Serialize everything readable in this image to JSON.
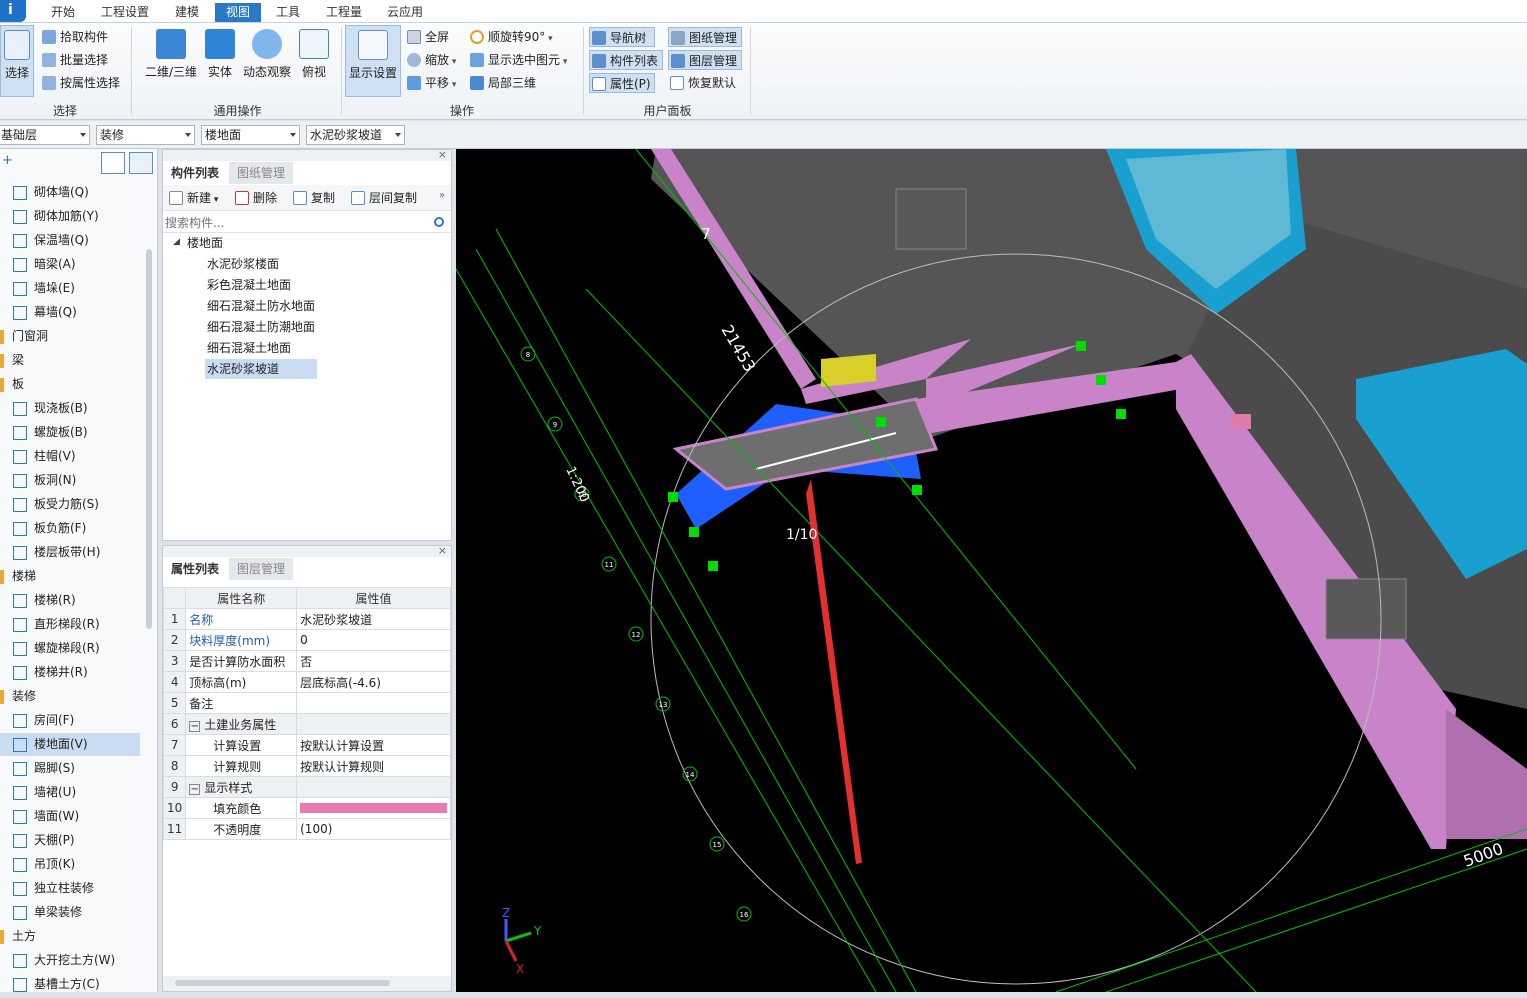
{
  "menu": {
    "tabs": [
      {
        "label": "开始",
        "active": false
      },
      {
        "label": "工程设置",
        "active": false
      },
      {
        "label": "建模",
        "active": false
      },
      {
        "label": "视图",
        "active": true
      },
      {
        "label": "工具",
        "active": false
      },
      {
        "label": "工程量",
        "active": false
      },
      {
        "label": "云应用",
        "active": false
      }
    ]
  },
  "ribbon": {
    "select_group": {
      "label": "选择",
      "select": "选择",
      "pick": "拾取构件",
      "batch": "批量选择",
      "by_attr": "按属性选择"
    },
    "general_group": {
      "label": "通用操作",
      "view2d3d": "二维/三维",
      "solid": "实体",
      "orbit": "动态观察",
      "top": "俯视"
    },
    "operate_group": {
      "label": "操作",
      "display": "显示设置",
      "fullscreen": "全屏",
      "zoom": "缩放",
      "pan": "平移",
      "rotate": "顺旋转90°",
      "show_selected": "显示选中图元",
      "local3d": "局部三维"
    },
    "panel_group": {
      "label": "用户面板",
      "nav_tree": "导航树",
      "drawing_mgmt": "图纸管理",
      "comp_list": "构件列表",
      "layer_mgmt": "图层管理",
      "props": "属性(P)",
      "restore": "恢复默认"
    }
  },
  "filters": {
    "floor": "基础层",
    "category": "装修",
    "type": "楼地面",
    "component": "水泥砂浆坡道"
  },
  "nav": {
    "items": [
      {
        "label": "砌体墙(Q)",
        "kind": "child"
      },
      {
        "label": "砌体加筋(Y)",
        "kind": "child"
      },
      {
        "label": "保温墙(Q)",
        "kind": "child"
      },
      {
        "label": "暗梁(A)",
        "kind": "child"
      },
      {
        "label": "墙垛(E)",
        "kind": "child"
      },
      {
        "label": "幕墙(Q)",
        "kind": "child"
      },
      {
        "label": "门窗洞",
        "kind": "group"
      },
      {
        "label": "梁",
        "kind": "group"
      },
      {
        "label": "板",
        "kind": "group"
      },
      {
        "label": "现浇板(B)",
        "kind": "child"
      },
      {
        "label": "螺旋板(B)",
        "kind": "child"
      },
      {
        "label": "柱帽(V)",
        "kind": "child"
      },
      {
        "label": "板洞(N)",
        "kind": "child"
      },
      {
        "label": "板受力筋(S)",
        "kind": "child"
      },
      {
        "label": "板负筋(F)",
        "kind": "child"
      },
      {
        "label": "楼层板带(H)",
        "kind": "child"
      },
      {
        "label": "楼梯",
        "kind": "group"
      },
      {
        "label": "楼梯(R)",
        "kind": "child"
      },
      {
        "label": "直形梯段(R)",
        "kind": "child"
      },
      {
        "label": "螺旋梯段(R)",
        "kind": "child"
      },
      {
        "label": "楼梯井(R)",
        "kind": "child"
      },
      {
        "label": "装修",
        "kind": "group"
      },
      {
        "label": "房间(F)",
        "kind": "child"
      },
      {
        "label": "楼地面(V)",
        "kind": "child",
        "selected": true
      },
      {
        "label": "踢脚(S)",
        "kind": "child"
      },
      {
        "label": "墙裙(U)",
        "kind": "child"
      },
      {
        "label": "墙面(W)",
        "kind": "child"
      },
      {
        "label": "天棚(P)",
        "kind": "child"
      },
      {
        "label": "吊顶(K)",
        "kind": "child"
      },
      {
        "label": "独立柱装修",
        "kind": "child"
      },
      {
        "label": "单梁装修",
        "kind": "child"
      },
      {
        "label": "土方",
        "kind": "group"
      },
      {
        "label": "大开挖土方(W)",
        "kind": "child"
      },
      {
        "label": "基槽土方(C)",
        "kind": "child"
      }
    ]
  },
  "comp_panel": {
    "tab_active": "构件列表",
    "tab_inactive": "图纸管理",
    "new": "新建",
    "delete": "删除",
    "copy": "复制",
    "floor_copy": "层间复制",
    "search_placeholder": "搜索构件...",
    "tree_root": "楼地面",
    "tree_items": [
      "水泥砂浆楼面",
      "彩色混凝土地面",
      "细石混凝土防水地面",
      "细石混凝土防潮地面",
      "细石混凝土地面",
      "水泥砂浆坡道"
    ]
  },
  "prop_panel": {
    "tab_active": "属性列表",
    "tab_inactive": "图层管理",
    "col_name": "属性名称",
    "col_value": "属性值",
    "rows": [
      {
        "n": "1",
        "name": "名称",
        "value": "水泥砂浆坡道",
        "blue": true
      },
      {
        "n": "2",
        "name": "块料厚度(mm)",
        "value": "0",
        "blue": true
      },
      {
        "n": "3",
        "name": "是否计算防水面积",
        "value": "否"
      },
      {
        "n": "4",
        "name": "顶标高(m)",
        "value": "层底标高(-4.6)"
      },
      {
        "n": "5",
        "name": "备注",
        "value": ""
      },
      {
        "n": "6",
        "name": "土建业务属性",
        "value": "",
        "group": true
      },
      {
        "n": "7",
        "name": "计算设置",
        "value": "按默认计算设置",
        "child": true
      },
      {
        "n": "8",
        "name": "计算规则",
        "value": "按默认计算规则",
        "child": true
      },
      {
        "n": "9",
        "name": "显示样式",
        "value": "",
        "group": true
      },
      {
        "n": "10",
        "name": "填充颜色",
        "value": "",
        "child": true,
        "color": "#e87ab3"
      },
      {
        "n": "11",
        "name": "不透明度",
        "value": "(100)",
        "child": true
      }
    ]
  },
  "viewport": {
    "labels": {
      "dim1": "21453",
      "scale": "1:200",
      "slope": "1/10",
      "dim2": "5000",
      "axis7": "7"
    },
    "axis_x": "X",
    "axis_y": "Y",
    "axis_z": "Z",
    "axis_numbers": [
      "7",
      "8",
      "9",
      "10",
      "11",
      "12",
      "13",
      "14",
      "15",
      "16"
    ],
    "colors": {
      "wall": "#c983c9",
      "floor": "#555555",
      "ramp_blue": "#1f5fff",
      "cyan": "#1aa0d0",
      "grid": "#00c000",
      "arrow": "#e03030",
      "yellow": "#d8cf2a"
    }
  }
}
